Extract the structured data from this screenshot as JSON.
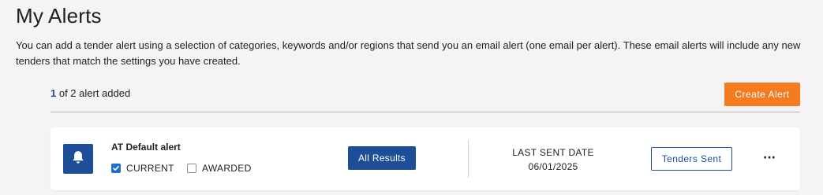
{
  "page": {
    "title": "My Alerts",
    "intro": "You can add a tender alert using a selection of categories, keywords and/or regions that send you an email alert (one email per alert). These email alerts will include any new tenders that match the settings you have created."
  },
  "alerts_summary": {
    "current_count": "1",
    "rest": " of 2 alert added"
  },
  "toolbar": {
    "create_label": "Create Alert"
  },
  "alert": {
    "icon": "bell-icon",
    "name": "AT Default alert",
    "current_label": "CURRENT",
    "current_checked": true,
    "awarded_label": "AWARDED",
    "awarded_checked": false,
    "results_label": "All Results",
    "last_sent_label": "LAST SENT DATE",
    "last_sent_value": "06/01/2025",
    "tenders_sent_label": "Tenders Sent",
    "more_label": "···"
  },
  "colors": {
    "primary": "#1f4e99",
    "accent": "#f47b20",
    "checkbox": "#1f6fd1",
    "background": "#f4f4f4"
  }
}
